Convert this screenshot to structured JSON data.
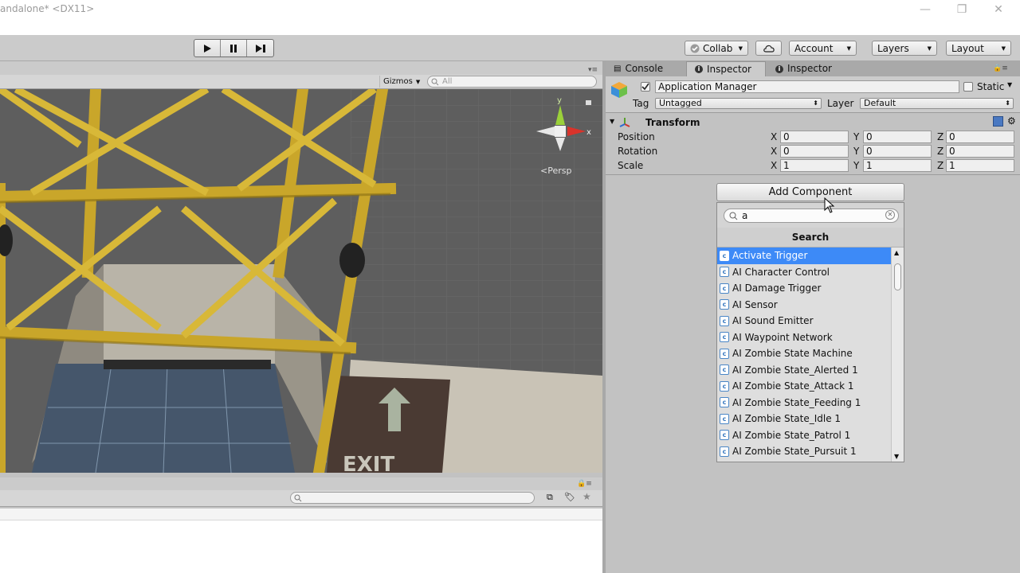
{
  "window": {
    "title": "andalone* <DX11>",
    "controls": [
      "—",
      "❐",
      "✕"
    ]
  },
  "toolbar": {
    "play_icon": "play-icon",
    "pause_icon": "pause-icon",
    "step_icon": "step-icon",
    "collab_label": "Collab",
    "account_label": "Account",
    "layers_label": "Layers",
    "layout_label": "Layout"
  },
  "scene": {
    "gizmos_label": "Gizmos",
    "search_placeholder": "All",
    "persp_label": "Persp",
    "gizmo_axes": {
      "y": "y",
      "x": "x"
    },
    "exit_sign": "EXIT"
  },
  "inspector": {
    "tabs": [
      {
        "label": "Console"
      },
      {
        "label": "Inspector"
      },
      {
        "label": "Inspector"
      }
    ],
    "object_name": "Application Manager",
    "static_label": "Static",
    "tag_label": "Tag",
    "tag_value": "Untagged",
    "layer_label": "Layer",
    "layer_value": "Default",
    "transform": {
      "title": "Transform",
      "rows": [
        {
          "label": "Position",
          "x": "0",
          "y": "0",
          "z": "0"
        },
        {
          "label": "Rotation",
          "x": "0",
          "y": "0",
          "z": "0"
        },
        {
          "label": "Scale",
          "x": "1",
          "y": "1",
          "z": "1"
        }
      ],
      "axis_x": "X",
      "axis_y": "Y",
      "axis_z": "Z"
    }
  },
  "add_component": {
    "button_label": "Add Component",
    "search_value": "a",
    "header": "Search",
    "items": [
      "Activate Trigger",
      "AI Character Control",
      "AI Damage Trigger",
      "AI Sensor",
      "AI Sound Emitter",
      "AI Waypoint Network",
      "AI Zombie State Machine",
      "AI Zombie State_Alerted 1",
      "AI Zombie State_Attack 1",
      "AI Zombie State_Feeding 1",
      "AI Zombie State_Idle 1",
      "AI Zombie State_Patrol 1",
      "AI Zombie State_Pursuit 1"
    ],
    "selected_index": 0
  },
  "colors": {
    "selection": "#3d8af7",
    "editor_bg": "#c2c2c2",
    "scaffold": "#c9a62a"
  }
}
